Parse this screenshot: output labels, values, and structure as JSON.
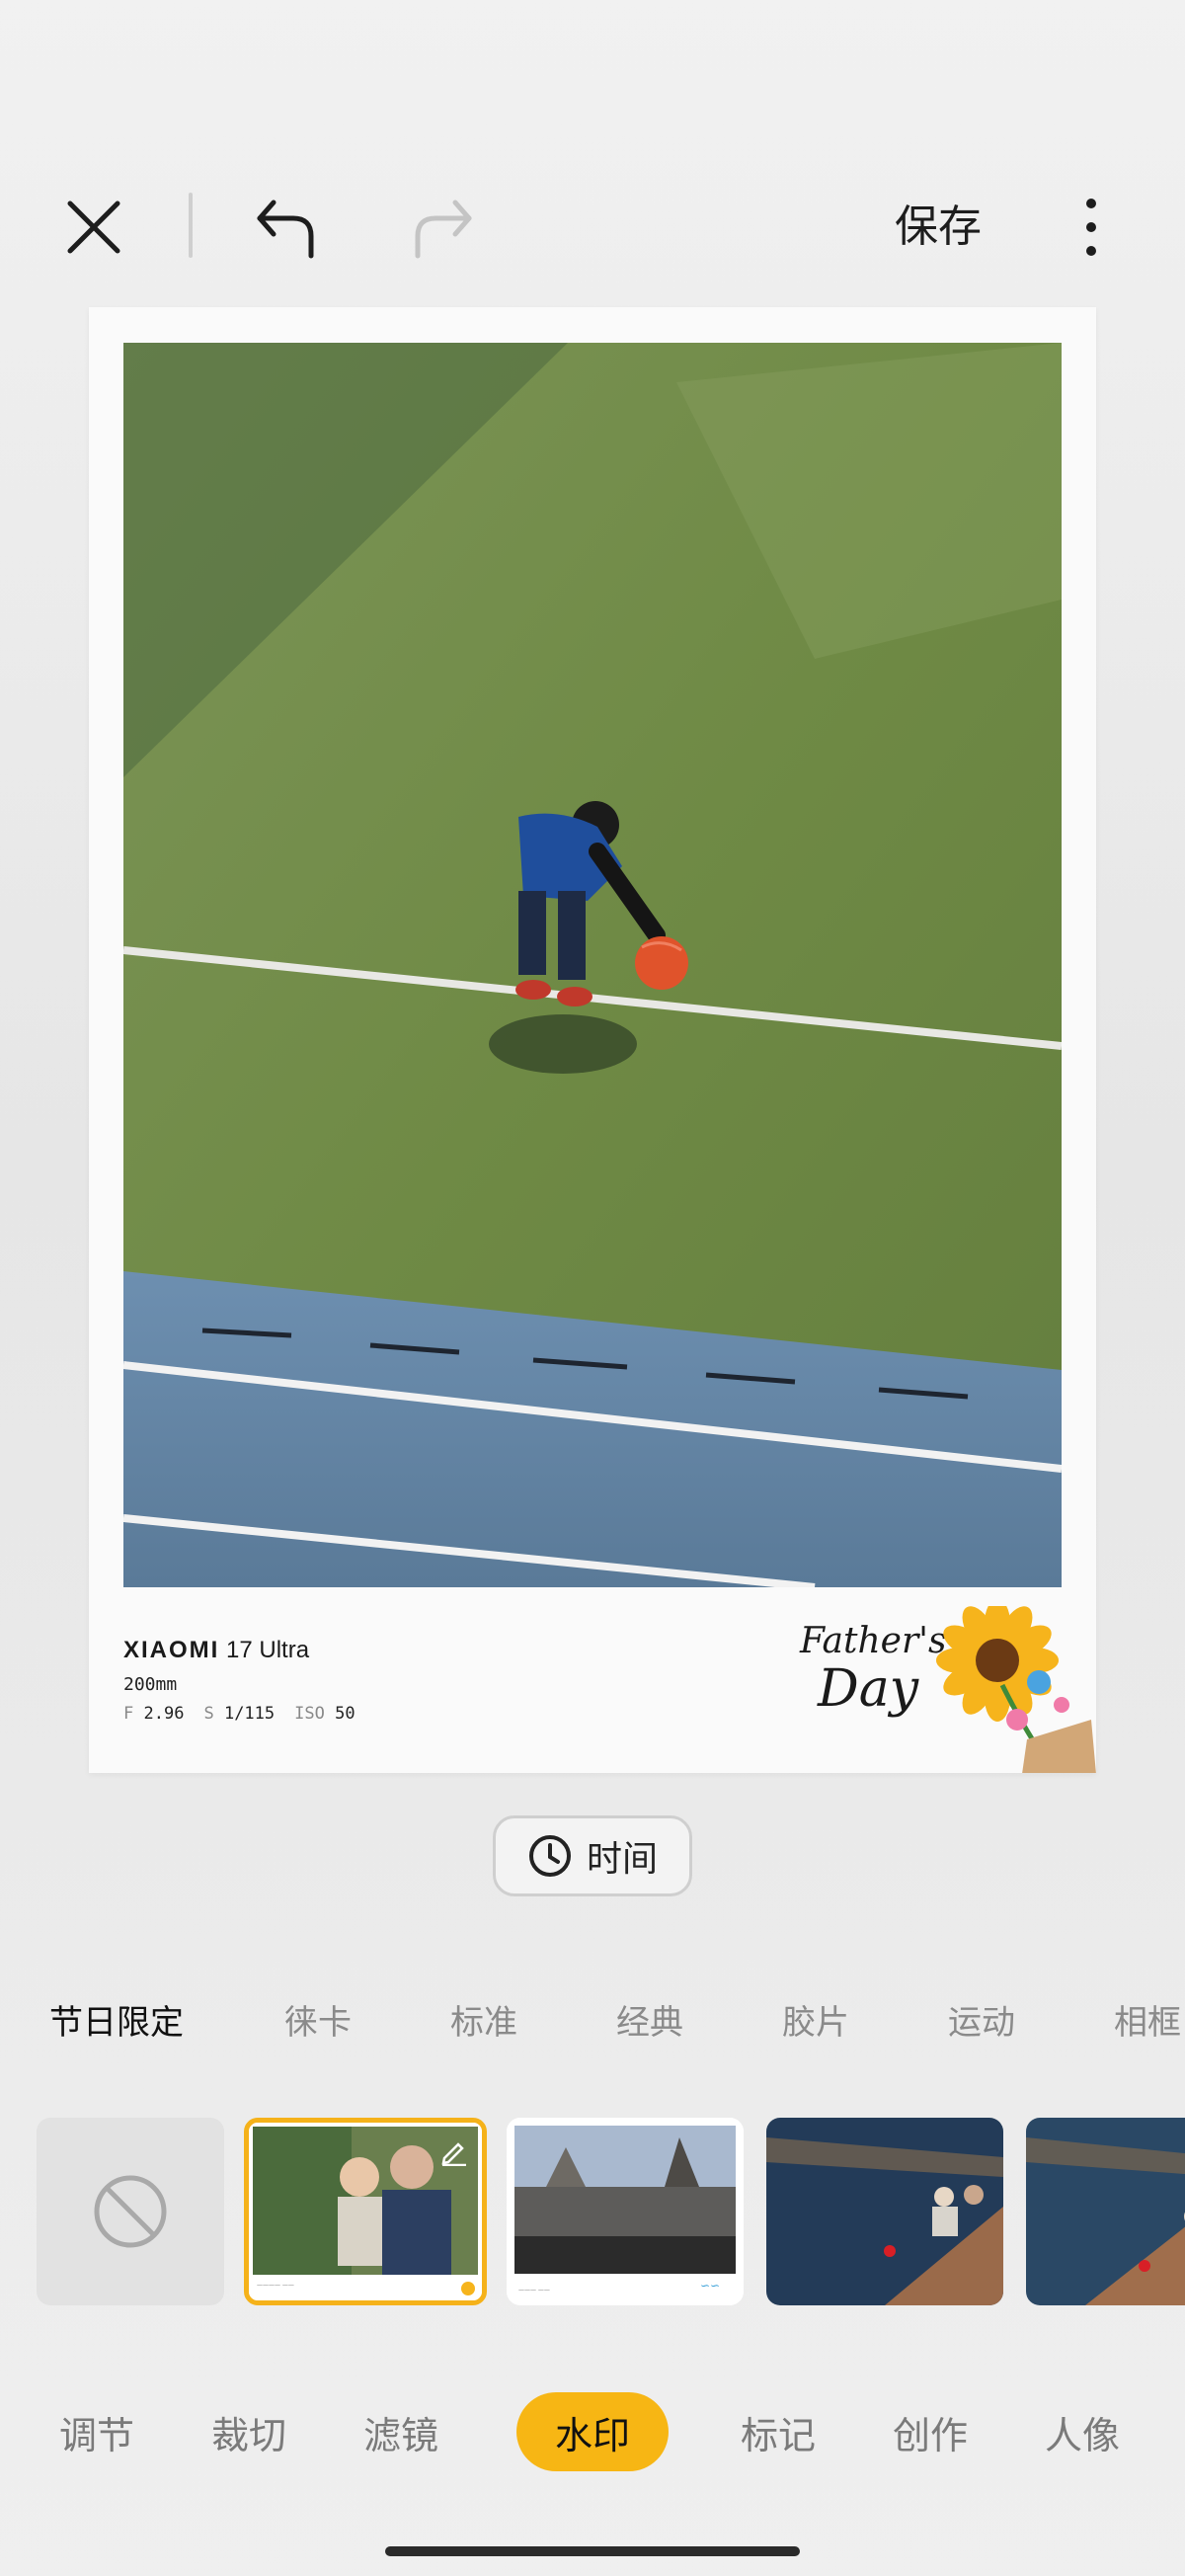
{
  "toolbar": {
    "close_icon": "close-icon",
    "undo_icon": "undo-icon",
    "redo_icon": "redo-icon",
    "save_label": "保存",
    "more_icon": "more-vertical-icon"
  },
  "watermark": {
    "brand": "XIAOMI",
    "model": "17 Ultra",
    "focal": "200mm",
    "exif": [
      {
        "key": "F",
        "value": "2.96"
      },
      {
        "key": "S",
        "value": "1/115"
      },
      {
        "key": "ISO",
        "value": "50"
      }
    ],
    "fathers_day_line1": "Father's",
    "fathers_day_line2": "Day"
  },
  "time_chip": {
    "label": "时间",
    "icon": "clock-icon"
  },
  "categories": [
    {
      "label": "节日限定",
      "active": true
    },
    {
      "label": "徕卡",
      "active": false
    },
    {
      "label": "标准",
      "active": false
    },
    {
      "label": "经典",
      "active": false
    },
    {
      "label": "胶片",
      "active": false
    },
    {
      "label": "运动",
      "active": false
    },
    {
      "label": "相框",
      "active": false
    }
  ],
  "thumbnails": {
    "none_icon": "no-watermark-icon",
    "selected_edit_icon": "pencil-icon"
  },
  "bottom_nav": [
    {
      "label": "调节",
      "active": false
    },
    {
      "label": "裁切",
      "active": false
    },
    {
      "label": "滤镜",
      "active": false
    },
    {
      "label": "水印",
      "active": true
    },
    {
      "label": "标记",
      "active": false
    },
    {
      "label": "创作",
      "active": false
    },
    {
      "label": "人像",
      "active": false
    }
  ],
  "colors": {
    "accent": "#f7b614",
    "selected_border": "#f5b21a",
    "field_green": "#6f8a45",
    "track_blue": "#5e7fa0"
  }
}
